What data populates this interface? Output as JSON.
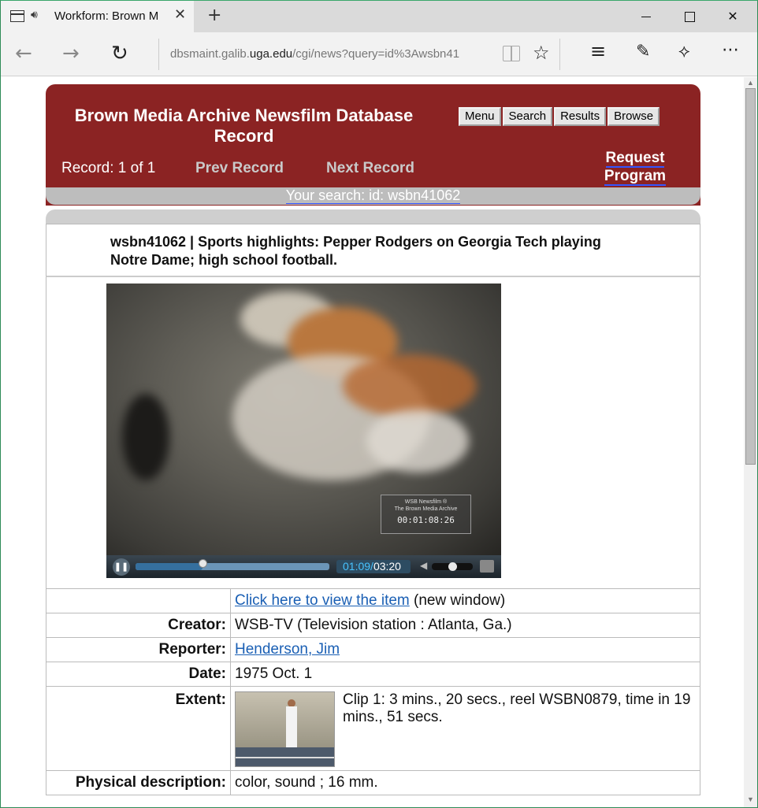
{
  "browser": {
    "tab_title": "Workform: Brown M",
    "url_prefix": "dbsmaint.galib.",
    "url_domain": "uga.edu",
    "url_suffix": "/cgi/news?query=id%3Awsbn41",
    "icons": [
      "tab-page-icon",
      "speaker-icon",
      "close-icon",
      "plus-icon",
      "back-icon",
      "forward-icon",
      "refresh-icon",
      "reading-view-icon",
      "star-icon",
      "hub-icon",
      "note-icon",
      "share-icon",
      "more-icon"
    ]
  },
  "header": {
    "title": "Brown Media Archive Newsfilm Database Record",
    "buttons": [
      "Menu",
      "Search",
      "Results",
      "Browse"
    ],
    "record_count": "Record: 1 of 1",
    "prev": "Prev Record",
    "next": "Next Record",
    "request_1": "Request",
    "request_2": "Program",
    "your_search": "Your search: id: wsbn41062",
    "accent_color": "#8b2323"
  },
  "record": {
    "title": "wsbn41062 | Sports highlights: Pepper Rodgers on Georgia Tech playing Notre Dame; high school football."
  },
  "player": {
    "watermark_line1": "WSB Newsfilm ®",
    "watermark_line2": "The Brown Media Archive",
    "timecode": "00:01:08:26",
    "current_time": "01:09/",
    "total_time": "03:20",
    "progress_fraction": 0.345
  },
  "metadata": {
    "view_link": "Click here to view the item",
    "view_note": " (new window)",
    "creator_label": "Creator:",
    "creator_value": "WSB-TV (Television station : Atlanta, Ga.)",
    "reporter_label": "Reporter:",
    "reporter_value": "Henderson, Jim",
    "date_label": "Date:",
    "date_value": "1975 Oct. 1",
    "extent_label": "Extent:",
    "extent_value": "Clip 1: 3 mins., 20 secs., reel WSBN0879, time in 19 mins., 51 secs.",
    "physical_label": "Physical description:",
    "physical_value": "color, sound ; 16 mm."
  }
}
